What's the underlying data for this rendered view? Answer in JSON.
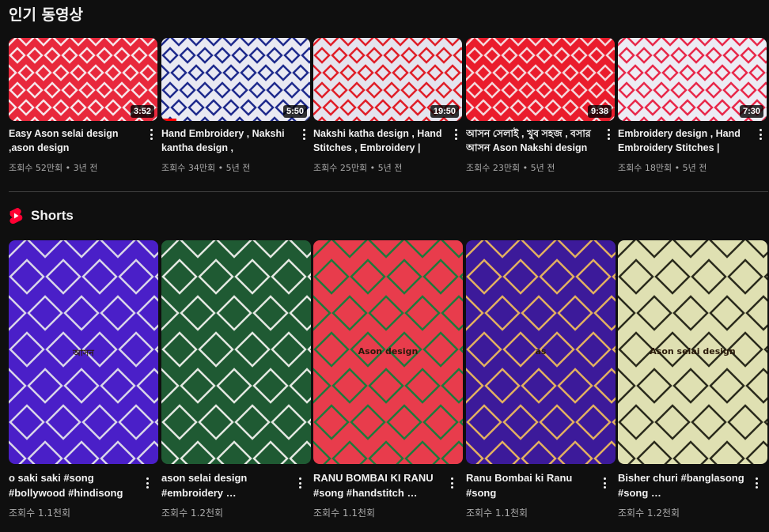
{
  "popular": {
    "title": "인기 동영상",
    "videos": [
      {
        "title": "Easy Ason selai design ,ason design @AngkitaAditiN",
        "meta": "조회수 52만회 • 3년 전",
        "duration": "3:52",
        "progress": 0,
        "colors": {
          "bg": "#e8283c",
          "fg": "#f6e6ea"
        }
      },
      {
        "title": "Hand Embroidery , Nakshi kantha design , Borderline…",
        "meta": "조회수 34만회 • 5년 전",
        "duration": "5:50",
        "progress": 0.1,
        "colors": {
          "bg": "#e9e9f2",
          "fg": "#1e2a8c"
        }
      },
      {
        "title": "Nakshi katha design , Hand Stitches , Embroidery | Han…",
        "meta": "조회수 25만회 • 5년 전",
        "duration": "19:50",
        "progress": 0,
        "colors": {
          "bg": "#e4e4ee",
          "fg": "#e01e28"
        }
      },
      {
        "title": "আসন সেলাই , খুব সহজ , বসার আসন Ason Nakshi design ,…",
        "meta": "조회수 23만회 • 5년 전",
        "duration": "9:38",
        "progress": 0,
        "colors": {
          "bg": "#ea1c2c",
          "fg": "#f4d8dc"
        }
      },
      {
        "title": "Embroidery design , Hand Embroidery Stitches | Hand…",
        "meta": "조회수 18만회 • 5년 전",
        "duration": "7:30",
        "progress": 0,
        "colors": {
          "bg": "#ececf4",
          "fg": "#e8284a"
        }
      }
    ]
  },
  "shorts": {
    "title": "Shorts",
    "items": [
      {
        "title": "o saki saki #song #bollywood #hindisong",
        "meta": "조회수 1.1천회",
        "overlay": "আসন",
        "colors": {
          "bg": "#4a1fc8",
          "fg": "#d9d6e8"
        }
      },
      {
        "title": "ason selai design #embroidery …",
        "meta": "조회수 1.2천회",
        "overlay": "",
        "colors": {
          "bg": "#1f5a33",
          "fg": "#e4e8e2"
        }
      },
      {
        "title": "RANU BOMBAI KI RANU #song #handstitch …",
        "meta": "조회수 1.1천회",
        "overlay": "Ason design",
        "colors": {
          "bg": "#e83c4c",
          "fg": "#1e7a3c"
        }
      },
      {
        "title": "Ranu Bombai ki Ranu #song",
        "meta": "조회수 1.1천회",
        "overlay": "as",
        "colors": {
          "bg": "#3c1a9a",
          "fg": "#e2b060"
        }
      },
      {
        "title": "Bisher churi #banglasong #song …",
        "meta": "조회수 1.2천회",
        "overlay": "Ason selai design",
        "colors": {
          "bg": "#dfe0b2",
          "fg": "#2a2a1c"
        }
      }
    ]
  }
}
